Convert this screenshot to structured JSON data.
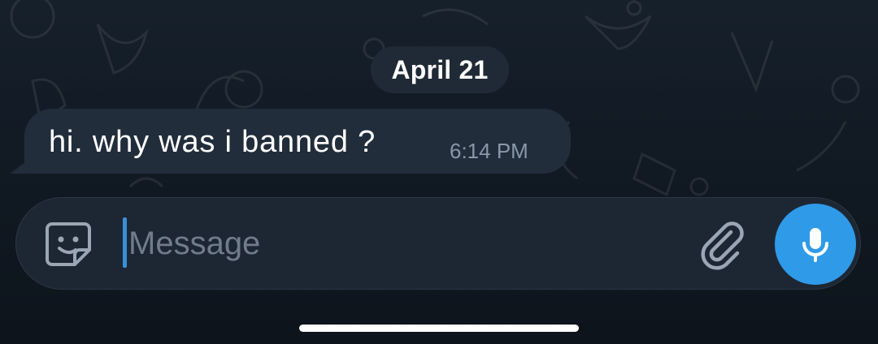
{
  "chat": {
    "date_separator": "April 21",
    "messages": [
      {
        "text": "hi. why was i banned ?",
        "time": "6:14 PM"
      }
    ]
  },
  "composer": {
    "placeholder": "Message",
    "icons": {
      "sticker": "sticker-smile-icon",
      "attach": "paperclip-icon",
      "voice": "microphone-icon"
    }
  },
  "colors": {
    "background": "#101821",
    "bubble": "#212d3b",
    "date_pill": "#1f2a36",
    "input_bar": "#1d2733",
    "accent": "#2f9ae8",
    "cursor": "#3a8fd8",
    "timestamp": "#8a97a6",
    "placeholder": "#6f7c8b"
  }
}
